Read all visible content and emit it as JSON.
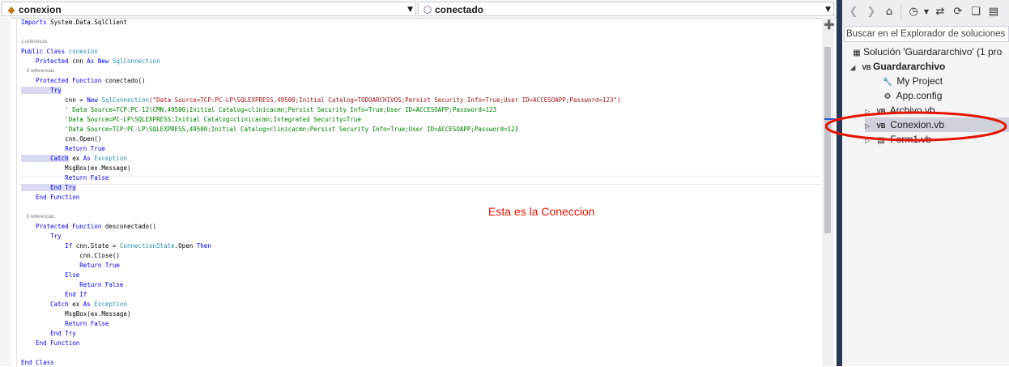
{
  "navbar": {
    "left_dropdown": {
      "label": "conexion",
      "icon": "class-icon"
    },
    "right_dropdown": {
      "label": "conectado",
      "icon": "method-icon"
    }
  },
  "code": {
    "lines": [
      [
        [
          "kw",
          "Imports"
        ],
        [
          "",
          "System.Data.SqlClient"
        ]
      ],
      [],
      [
        [
          "cl",
          "1 referencia"
        ]
      ],
      [
        [
          "kw",
          "Public Class"
        ],
        [
          "tp",
          "conexion"
        ]
      ],
      [
        [
          "kw",
          "    Protected"
        ],
        [
          "",
          "cnn"
        ],
        [
          "kw",
          "As New"
        ],
        [
          "tp",
          "SqlConnection"
        ]
      ],
      [
        [
          "cl",
          "    3 referencias"
        ]
      ],
      [
        [
          "kw",
          "    Protected Function"
        ],
        [
          "",
          "conectado()"
        ]
      ],
      [
        [
          "kw hl",
          "        Try"
        ]
      ],
      [
        [
          "",
          "            cnn = "
        ],
        [
          "kw",
          "New"
        ],
        [
          "tp",
          "SqlConnection"
        ],
        [
          "st",
          "(\"Data Source=TCP:PC-LP\\SQLEXPRESS,49500;Initial Catalog=TODOARCHIVOS;Persist Security Info=True;User ID=ACCESOAPP;Password=123\")"
        ]
      ],
      [
        [
          "cm",
          "            ' Data Source=TCP:PC-12\\CMN,49500;Initial Catalog=clinicacmn;Persist Security Info=True;User ID=ACCESOAPP;Password=123"
        ]
      ],
      [
        [
          "cm",
          "            'Data Source=PC-LP\\SQLEXPRESS;Initial Catalog=clinicacmn;Integrated Security=True"
        ]
      ],
      [
        [
          "cm",
          "            'Data Source=TCP:PC-LP\\SQLEXPRESS,49500;Initial Catalog=clinicacmn;Persist Security Info=True;User ID=ACCESOAPP;Password=123"
        ]
      ],
      [
        [
          "",
          "            cnn.Open()"
        ]
      ],
      [
        [
          "kw",
          "            Return True"
        ]
      ],
      [
        [
          "kw hl",
          "        Catch"
        ],
        [
          "",
          "ex"
        ],
        [
          "kw",
          "As"
        ],
        [
          "tp",
          "Exception"
        ]
      ],
      [
        [
          "",
          "            MsgBox(ex.Message)"
        ]
      ],
      [
        [
          "kw",
          "            Return False"
        ]
      ],
      [
        [
          "kw hl",
          "        End Try"
        ]
      ],
      [
        [
          "kw",
          "    End Function"
        ]
      ],
      [],
      [
        [
          "cl",
          "    3 referencias"
        ]
      ],
      [
        [
          "kw",
          "    Protected Function"
        ],
        [
          "",
          "desconectado()"
        ]
      ],
      [
        [
          "kw",
          "        Try"
        ]
      ],
      [
        [
          "kw",
          "            If"
        ],
        [
          "",
          "cnn.State ="
        ],
        [
          "tp",
          "ConnectionState"
        ],
        [
          "",
          ".Open"
        ],
        [
          "kw",
          "Then"
        ]
      ],
      [
        [
          "",
          "                cnn.Close()"
        ]
      ],
      [
        [
          "kw",
          "                Return True"
        ]
      ],
      [
        [
          "kw",
          "            Else"
        ]
      ],
      [
        [
          "kw",
          "                Return False"
        ]
      ],
      [
        [
          "kw",
          "            End If"
        ]
      ],
      [
        [
          "kw",
          "        Catch"
        ],
        [
          "",
          "ex"
        ],
        [
          "kw",
          "As"
        ],
        [
          "tp",
          "Exception"
        ]
      ],
      [
        [
          "",
          "            MsgBox(ex.Message)"
        ]
      ],
      [
        [
          "kw",
          "            Return False"
        ]
      ],
      [
        [
          "kw",
          "        End Try"
        ]
      ],
      [
        [
          "kw",
          "    End Function"
        ]
      ],
      [],
      [
        [
          "kw",
          "End Class"
        ]
      ]
    ]
  },
  "annotation": "Esta es la Coneccion",
  "solution_explorer": {
    "toolbar_icons": [
      "back-icon",
      "forward-icon",
      "home-icon",
      "history-icon",
      "sync-icon",
      "refresh-icon",
      "collapse-all-icon",
      "show-all-files-icon"
    ],
    "search_placeholder": "Buscar en el Explorador de soluciones",
    "tree": [
      {
        "label": "Solución 'Guardararchivo'  (1 pro",
        "icon": "solution-icon",
        "expanded": null,
        "bold": false
      },
      {
        "label": "Guardararchivo",
        "icon": "vb-project-icon",
        "expanded": true,
        "bold": true
      },
      {
        "label": "My Project",
        "icon": "wrench-icon",
        "expanded": null,
        "bold": false
      },
      {
        "label": "App.config",
        "icon": "config-icon",
        "expanded": null,
        "bold": false
      },
      {
        "label": "Archivo.vb",
        "icon": "vb-file-icon",
        "expanded": false,
        "bold": false
      },
      {
        "label": "Conexion.vb",
        "icon": "vb-file-icon",
        "expanded": false,
        "bold": false,
        "selected": true
      },
      {
        "label": "Form1.vb",
        "icon": "form-icon",
        "expanded": false,
        "bold": false
      }
    ]
  },
  "colors": {
    "keyword": "#0000ff",
    "type": "#2b91af",
    "string": "#a31515",
    "comment": "#008000",
    "annotation": "#e51400",
    "selection": "#cfd1dd",
    "divider": "#293955"
  }
}
